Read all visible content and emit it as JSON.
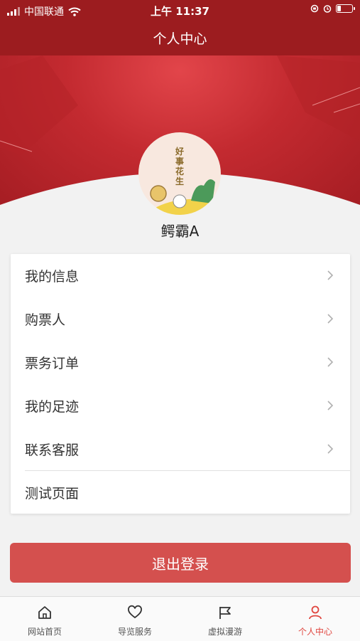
{
  "status_bar": {
    "carrier": "中国联通",
    "time": "上午 11:37"
  },
  "header": {
    "title": "个人中心"
  },
  "profile": {
    "avatar_text": "好事花生",
    "username": "鳄霸A"
  },
  "menu": [
    {
      "label": "我的信息",
      "has_arrow": true
    },
    {
      "label": "购票人",
      "has_arrow": true
    },
    {
      "label": "票务订单",
      "has_arrow": true
    },
    {
      "label": "我的足迹",
      "has_arrow": true
    },
    {
      "label": "联系客服",
      "has_arrow": true
    },
    {
      "label": "测试页面",
      "has_arrow": false
    }
  ],
  "logout_label": "退出登录",
  "tabs": [
    {
      "label": "网站首页",
      "icon": "home-icon",
      "active": false
    },
    {
      "label": "导览服务",
      "icon": "heart-icon",
      "active": false
    },
    {
      "label": "虚拟漫游",
      "icon": "flag-icon",
      "active": false
    },
    {
      "label": "个人中心",
      "icon": "person-icon",
      "active": true
    }
  ],
  "colors": {
    "header": "#9c1c1f",
    "accent": "#e0463f",
    "logout": "#d4504e"
  }
}
